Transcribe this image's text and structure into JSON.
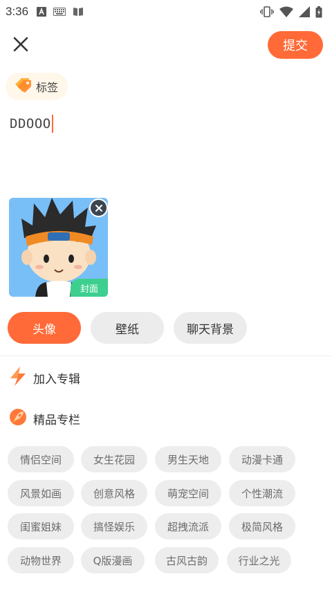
{
  "status_bar": {
    "time": "3:36",
    "left_icons": [
      "font-icon",
      "keyboard-icon",
      "book-icon"
    ],
    "right_icons": [
      "vibrate-icon",
      "wifi-icon",
      "signal-icon",
      "battery-icon"
    ]
  },
  "header": {
    "close_icon": "close-icon",
    "submit_label": "提交"
  },
  "tag": {
    "icon": "tag-icon",
    "label": "标签"
  },
  "post": {
    "text": "DDOOO"
  },
  "image": {
    "cover_label": "封面",
    "remove_icon": "close-icon"
  },
  "categories": [
    {
      "label": "头像",
      "active": true
    },
    {
      "label": "壁纸",
      "active": false
    },
    {
      "label": "聊天背景",
      "active": false
    }
  ],
  "options": [
    {
      "label": "加入专辑",
      "icon": "lightning-icon"
    },
    {
      "label": "精品专栏",
      "icon": "rocket-icon"
    }
  ],
  "topics": [
    [
      "情侣空间",
      "女生花园",
      "男生天地",
      "动漫卡通"
    ],
    [
      "风景如画",
      "创意风格",
      "萌宠空间",
      "个性潮流"
    ],
    [
      "闺蜜姐妹",
      "搞怪娱乐",
      "超拽流派",
      "极简风格"
    ],
    [
      "动物世界",
      "Q版漫画",
      "古风古韵",
      "行业之光"
    ]
  ],
  "colors": {
    "accent": "#ff6a38",
    "cover_badge": "#3ccf8e",
    "chip_bg": "#ededed",
    "tag_bg": "#fff7ea"
  }
}
